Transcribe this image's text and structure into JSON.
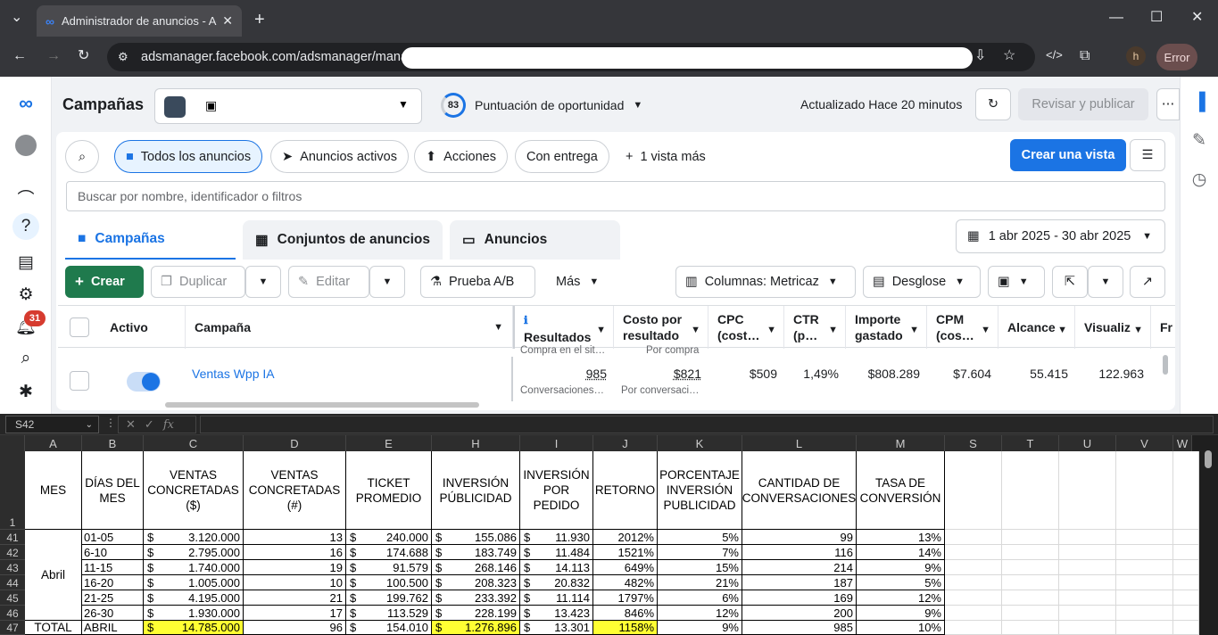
{
  "browser": {
    "tab_title": "Administrador de anuncios - Ad",
    "url": "adsmanager.facebook.com/adsmanager/manag",
    "profile_initial": "h",
    "error_label": "Error"
  },
  "header": {
    "title": "Campañas",
    "opportunity_score": "83",
    "opportunity_label": "Puntuación de oportunidad",
    "updated": "Actualizado Hace 20 minutos",
    "review_publish": "Revisar y publicar"
  },
  "sidebar": {
    "notifications_count": "31"
  },
  "filters": {
    "all_ads": "Todos los anuncios",
    "active_ads": "Anuncios activos",
    "actions": "Acciones",
    "with_delivery": "Con entrega",
    "more_views": "1 vista más",
    "create_view": "Crear una vista",
    "search_placeholder": "Buscar por nombre, identificador o filtros"
  },
  "level_tabs": {
    "campaigns": "Campañas",
    "ad_sets": "Conjuntos de anuncios",
    "ads": "Anuncios"
  },
  "date_range": "1 abr 2025 - 30 abr 2025",
  "toolbar": {
    "create": "Crear",
    "duplicate": "Duplicar",
    "edit": "Editar",
    "ab_test": "Prueba A/B",
    "more": "Más",
    "columns": "Columnas: Metricaz",
    "breakdown": "Desglose"
  },
  "table": {
    "headers": {
      "active": "Activo",
      "campaign": "Campaña",
      "results": "Resultados",
      "cost_per_result": "Costo por resultado",
      "cpc": "CPC (cost…",
      "ctr": "CTR (p…",
      "spent": "Importe gastado",
      "cpm": "CPM (cos…",
      "reach": "Alcance",
      "views": "Visualiz",
      "fr": "Fr"
    },
    "prev_sub_results": "Compra en el sit…",
    "prev_sub_cost": "Por compra",
    "row": {
      "name": "Ventas Wpp IA",
      "results": "985",
      "results_sub": "Conversaciones…",
      "cost": "$821",
      "cost_sub": "Por conversaci…",
      "cpc": "$509",
      "ctr": "1,49%",
      "spent": "$808.289",
      "cpm": "$7.604",
      "reach": "55.415",
      "views": "122.963"
    }
  },
  "excel": {
    "name_box": "S42",
    "fx": "fx",
    "columns": [
      "A",
      "B",
      "C",
      "D",
      "E",
      "H",
      "I",
      "J",
      "K",
      "L",
      "M",
      "S",
      "T",
      "U",
      "V",
      "W"
    ],
    "headers": [
      "MES",
      "DÍAS DEL MES",
      "VENTAS CONCRETADAS ($)",
      "VENTAS CONCRETADAS (#)",
      "TICKET PROMEDIO",
      "INVERSIÓN PÚBLICIDAD",
      "INVERSIÓN POR PEDIDO",
      "RETORNO",
      "PORCENTAJE INVERSIÓN PUBLICIDAD",
      "CANTIDAD DE CONVERSACIONES",
      "TASA DE CONVERSIÓN"
    ],
    "month": "Abril",
    "currency": "$",
    "rows": [
      {
        "n": "41",
        "b": "01-05",
        "c": "3.120.000",
        "d": "13",
        "e": "240.000",
        "h": "155.086",
        "i": "11.930",
        "j": "2012%",
        "k": "5%",
        "l": "99",
        "m": "13%"
      },
      {
        "n": "42",
        "b": "6-10",
        "c": "2.795.000",
        "d": "16",
        "e": "174.688",
        "h": "183.749",
        "i": "11.484",
        "j": "1521%",
        "k": "7%",
        "l": "116",
        "m": "14%"
      },
      {
        "n": "43",
        "b": "11-15",
        "c": "1.740.000",
        "d": "19",
        "e": "91.579",
        "h": "268.146",
        "i": "14.113",
        "j": "649%",
        "k": "15%",
        "l": "214",
        "m": "9%"
      },
      {
        "n": "44",
        "b": "16-20",
        "c": "1.005.000",
        "d": "10",
        "e": "100.500",
        "h": "208.323",
        "i": "20.832",
        "j": "482%",
        "k": "21%",
        "l": "187",
        "m": "5%"
      },
      {
        "n": "45",
        "b": "21-25",
        "c": "4.195.000",
        "d": "21",
        "e": "199.762",
        "h": "233.392",
        "i": "11.114",
        "j": "1797%",
        "k": "6%",
        "l": "169",
        "m": "12%"
      },
      {
        "n": "46",
        "b": "26-30",
        "c": "1.930.000",
        "d": "17",
        "e": "113.529",
        "h": "228.199",
        "i": "13.423",
        "j": "846%",
        "k": "12%",
        "l": "200",
        "m": "9%"
      }
    ],
    "total": {
      "n": "47",
      "a": "TOTAL",
      "b": "ABRIL",
      "c": "14.785.000",
      "d": "96",
      "e": "154.010",
      "h": "1.276.896",
      "i": "13.301",
      "j": "1158%",
      "k": "9%",
      "l": "985",
      "m": "10%"
    },
    "header_row_num": "1"
  },
  "colors": {
    "accent": "#1b74e4",
    "create_green": "#1f7a4d",
    "highlight": "#ffff33"
  }
}
